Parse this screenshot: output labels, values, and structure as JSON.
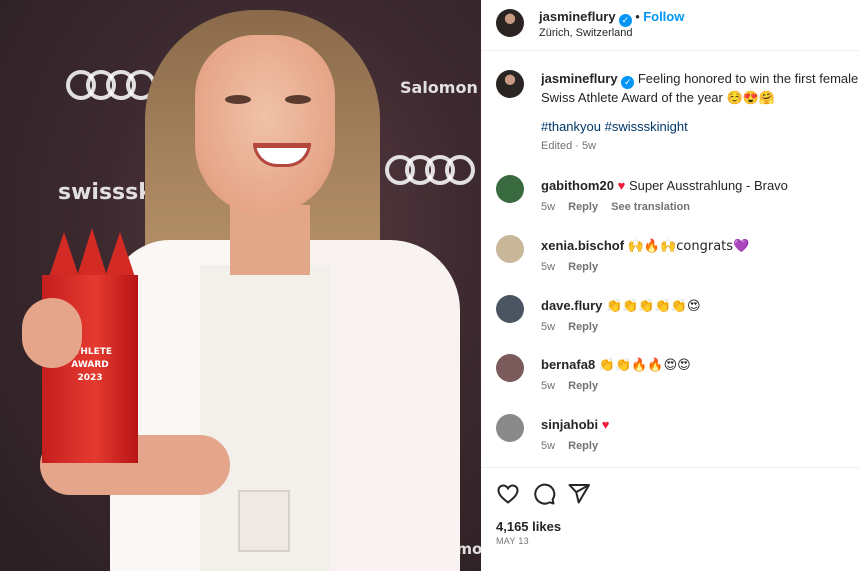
{
  "photo": {
    "award_lines": [
      "ATHLETE",
      "AWARD",
      "2023"
    ],
    "backdrop_logos": [
      "Audi",
      "swissski",
      "Salomon"
    ]
  },
  "post": {
    "username": "jasmineflury",
    "location": "Zürich, Switzerland",
    "follow_label": "Follow",
    "separator": "•",
    "verified_icon": "verified-badge-icon",
    "caption": "Feeling honored to win the first female Swiss Athlete Award of the year ☺️😍🤗",
    "hashtags": "#thankyou #swissskinight",
    "caption_meta": "Edited · 5w"
  },
  "comments": [
    {
      "user": "gabithom20",
      "heart": "♥",
      "text": "Super Ausstrahlung - Bravo",
      "time": "5w",
      "reply": "Reply",
      "extra": "See translation",
      "avatar_color": "#3a6a3f"
    },
    {
      "user": "xenia.bischof",
      "heart": "",
      "text": "🙌🔥🙌congrats💜",
      "time": "5w",
      "reply": "Reply",
      "extra": "",
      "avatar_color": "#c9b79a"
    },
    {
      "user": "dave.flury",
      "heart": "",
      "text": "👏👏👏👏👏😍",
      "time": "5w",
      "reply": "Reply",
      "extra": "",
      "avatar_color": "#4a5561"
    },
    {
      "user": "bernafa8",
      "heart": "",
      "text": "👏👏🔥🔥😍😍",
      "time": "5w",
      "reply": "Reply",
      "extra": "",
      "avatar_color": "#7a5a5a"
    },
    {
      "user": "sinjahobi",
      "heart": "♥",
      "text": "",
      "time": "5w",
      "reply": "Reply",
      "extra": "",
      "avatar_color": "#8a8a8a"
    }
  ],
  "footer": {
    "likes": "4,165 likes",
    "date": "MAY 13"
  },
  "colors": {
    "accent": "#0095f6",
    "heart": "#ed1c3a",
    "hashtag": "#00376b",
    "muted": "#737373"
  }
}
